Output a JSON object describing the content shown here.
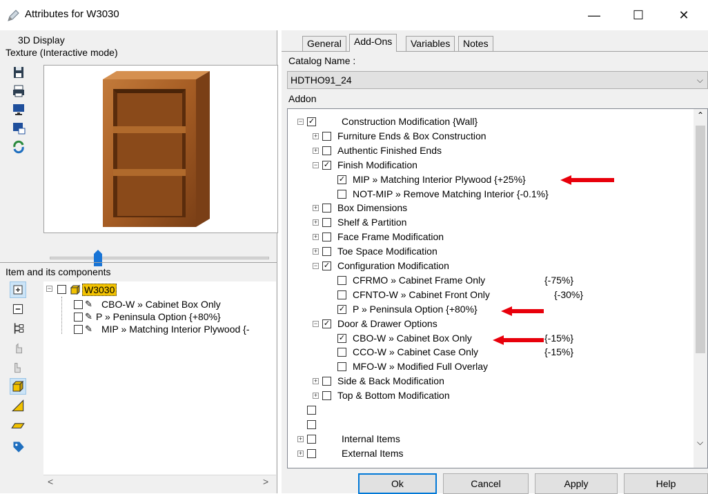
{
  "window": {
    "title": "Attributes for W3030",
    "minimize": "—",
    "maximize": "☐",
    "close": "✕"
  },
  "left": {
    "display_group_label": "3D Display",
    "texture_label": "Texture (Interactive mode)",
    "toolbar_icons": [
      "save-icon",
      "print-icon",
      "monitor-icon",
      "window-export-icon",
      "refresh-icon"
    ],
    "slider_value": 0.22,
    "items_group_label": "Item and its components",
    "side_icons": [
      "expand-icon",
      "collapse-icon",
      "hierarchy-icon",
      "hand-pointer-icon",
      "hand-pointer-alt-icon",
      "cabinet-3d-icon",
      "drawing-icon",
      "panel-icon",
      "tag-icon"
    ],
    "tree": {
      "root": "W3030",
      "children": [
        "CBO-W » Cabinet Box Only",
        "P » Peninsula Option  {+80%}",
        "MIP » Matching Interior Plywood  {-"
      ]
    }
  },
  "right": {
    "tabs": [
      "General",
      "Add-Ons",
      "Variables",
      "Notes"
    ],
    "active_tab": "Add-Ons",
    "catalog_label": "Catalog Name :",
    "catalog_value": "HDTHO91_24",
    "addon_label": "Addon",
    "tree_rows": [
      {
        "level": 0,
        "exp": "−",
        "checked": true,
        "text": "Construction Modification {Wall}",
        "price": ""
      },
      {
        "level": 1,
        "exp": "+",
        "checked": false,
        "text": "Furniture Ends & Box Construction",
        "price": ""
      },
      {
        "level": 1,
        "exp": "+",
        "checked": false,
        "text": "Authentic Finished Ends",
        "price": ""
      },
      {
        "level": 1,
        "exp": "−",
        "checked": true,
        "text": "Finish Modification",
        "price": ""
      },
      {
        "level": 2,
        "exp": "",
        "checked": true,
        "text": "MIP » Matching Interior Plywood  {+25%}",
        "price": ""
      },
      {
        "level": 2,
        "exp": "",
        "checked": false,
        "text": "NOT-MIP » Remove Matching Interior {-0.1%}",
        "price": ""
      },
      {
        "level": 1,
        "exp": "+",
        "checked": false,
        "text": "Box Dimensions",
        "price": ""
      },
      {
        "level": 1,
        "exp": "+",
        "checked": false,
        "text": "Shelf & Partition",
        "price": ""
      },
      {
        "level": 1,
        "exp": "+",
        "checked": false,
        "text": "Face Frame Modification",
        "price": ""
      },
      {
        "level": 1,
        "exp": "+",
        "checked": false,
        "text": "Toe Space Modification",
        "price": ""
      },
      {
        "level": 1,
        "exp": "−",
        "checked": true,
        "text": "Configuration Modification",
        "price": ""
      },
      {
        "level": 2,
        "exp": "",
        "checked": false,
        "text": "CFRMO » Cabinet Frame Only",
        "price": "{-75%}"
      },
      {
        "level": 2,
        "exp": "",
        "checked": false,
        "text": "CFNTO-W » Cabinet Front Only",
        "price": "{-30%}"
      },
      {
        "level": 2,
        "exp": "",
        "checked": true,
        "text": "P » Peninsula Option  {+80%}",
        "price": ""
      },
      {
        "level": 1,
        "exp": "−",
        "checked": true,
        "text": "Door & Drawer Options",
        "price": ""
      },
      {
        "level": 2,
        "exp": "",
        "checked": true,
        "text": "CBO-W » Cabinet Box Only",
        "price": "{-15%}"
      },
      {
        "level": 2,
        "exp": "",
        "checked": false,
        "text": "CCO-W » Cabinet Case Only",
        "price": "{-15%}"
      },
      {
        "level": 2,
        "exp": "",
        "checked": false,
        "text": "MFO-W » Modified Full Overlay",
        "price": ""
      },
      {
        "level": 1,
        "exp": "+",
        "checked": false,
        "text": "Side & Back Modification",
        "price": ""
      },
      {
        "level": 1,
        "exp": "+",
        "checked": false,
        "text": "Top & Bottom Modification",
        "price": ""
      },
      {
        "level": 0,
        "exp": "",
        "checked": false,
        "text": "",
        "price": ""
      },
      {
        "level": 0,
        "exp": "",
        "checked": false,
        "text": "",
        "price": ""
      },
      {
        "level": 0,
        "exp": "+",
        "checked": false,
        "text": "Internal Items",
        "price": ""
      },
      {
        "level": 0,
        "exp": "+",
        "checked": false,
        "text": "External Items",
        "price": ""
      }
    ],
    "buttons": {
      "ok": "Ok",
      "cancel": "Cancel",
      "apply": "Apply",
      "help": "Help"
    }
  },
  "colors": {
    "arrow": "#e8000b",
    "accent": "#0078d7"
  }
}
